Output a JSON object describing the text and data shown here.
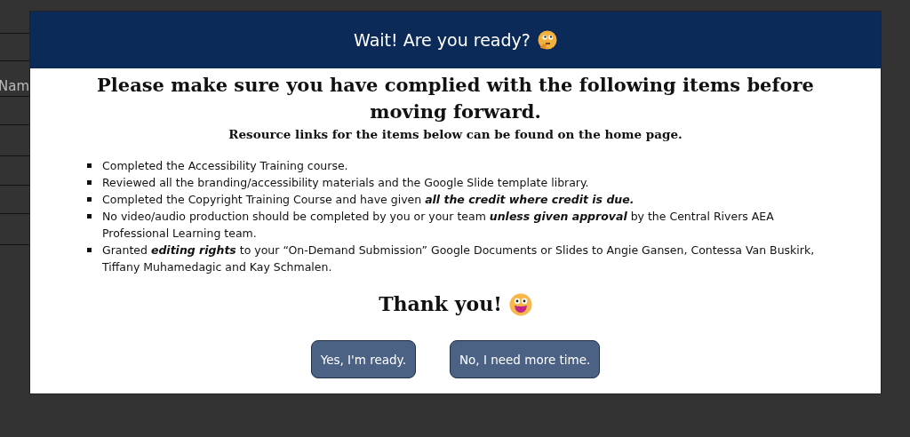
{
  "background": {
    "label": "Nam"
  },
  "modal": {
    "title": "Wait! Are you ready?",
    "heading": "Please make sure you have complied with the following items before moving forward.",
    "subheading": "Resource links for the items below can be found on the home page.",
    "items": [
      "Completed the Accessibility Training course.",
      "Reviewed all the branding/accessibility materials and the Google Slide template library.",
      "Completed the Copyright Training Course and have given **all the credit where credit is due.**",
      "No video/audio production should be completed by you or your team **unless given approval** by the Central Rivers AEA Professional Learning team.",
      "Granted **editing rights** to your “On-Demand Submission” Google Documents or Slides to Angie Gansen, Contessa Van Buskirk, Tiffany Muhamedagic and Kay Schmalen."
    ],
    "thanks": "Thank you!",
    "buttons": [
      "Yes, I'm ready.",
      "No, I need more time."
    ]
  }
}
